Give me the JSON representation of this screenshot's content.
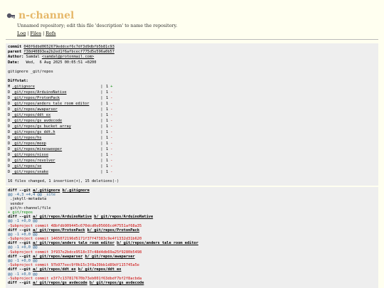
{
  "header": {
    "repo_name": "n-channel",
    "description": "Unnamed repository; edit this file 'description' to name the repository.",
    "nav": {
      "log": "Log",
      "files": "Files",
      "refs": "Refs",
      "sep": "|"
    }
  },
  "commit": {
    "commit_label": "commit",
    "commit_hash": "048f6dbd0652679eddcef6c7df3d9dbfb5b81c93",
    "parent_label": "parent",
    "parent_hash": "f38d40893ea2b2ed1f6afbcecf775d5e596a0b57",
    "author_label": "Author:",
    "author_name": "Samdal",
    "author_email": "<samdal@protonmail.com>",
    "date_label": "Date:",
    "date_value": "Wed,  6 Aug 2025 00:05:51 +0200",
    "message": "gitignore _git/repos",
    "diffstat_label": "Diffstat:",
    "stats": [
      {
        "mode": "M",
        "file": ".gitignore",
        "changes": "1",
        "sign": "+"
      },
      {
        "mode": "D",
        "file": "_git/repos/ArduinoNative",
        "changes": "1",
        "sign": "-"
      },
      {
        "mode": "D",
        "file": "_git/repos/ProtonPack",
        "changes": "1",
        "sign": "-"
      },
      {
        "mode": "D",
        "file": "_git/repos/anders_tale_room_editor",
        "changes": "1",
        "sign": "-"
      },
      {
        "mode": "D",
        "file": "_git/repos/awaparser",
        "changes": "1",
        "sign": "-"
      },
      {
        "mode": "D",
        "file": "_git/repos/ddt_ex",
        "changes": "1",
        "sign": "-"
      },
      {
        "mode": "D",
        "file": "_git/repos/gs_avdecode",
        "changes": "1",
        "sign": "-"
      },
      {
        "mode": "D",
        "file": "_git/repos/gs_bucket_array",
        "changes": "1",
        "sign": "-"
      },
      {
        "mode": "D",
        "file": "_git/repos/gs_ddt.h",
        "changes": "1",
        "sign": "-"
      },
      {
        "mode": "D",
        "file": "_git/repos/hs",
        "changes": "1",
        "sign": "-"
      },
      {
        "mode": "D",
        "file": "_git/repos/meep",
        "changes": "1",
        "sign": "-"
      },
      {
        "mode": "D",
        "file": "_git/repos/minesweeper",
        "changes": "1",
        "sign": "-"
      },
      {
        "mode": "D",
        "file": "_git/repos/nisse",
        "changes": "1",
        "sign": "-"
      },
      {
        "mode": "D",
        "file": "_git/repos/revolver",
        "changes": "1",
        "sign": "-"
      },
      {
        "mode": "D",
        "file": "_git/repos/se",
        "changes": "1",
        "sign": "-"
      },
      {
        "mode": "D",
        "file": "_git/repos/snake",
        "changes": "1",
        "sign": "-"
      }
    ],
    "summary": "16 files changed, 1 insertion(+), 15 deletions(-)"
  },
  "diff": [
    {
      "type": "head",
      "a": "a/.gitignore",
      "b": "b/.gitignore",
      "prefix": "diff --git "
    },
    {
      "type": "hunk",
      "text": "@@ -4,3 +4,4 @@ _site"
    },
    {
      "type": "ctx",
      "text": " .jekyll-metadata"
    },
    {
      "type": "ctx",
      "text": " vendor"
    },
    {
      "type": "ctx",
      "text": " git/n-channel/file"
    },
    {
      "type": "add",
      "text": "+_git/repos"
    },
    {
      "type": "head",
      "a": "a/_git/repos/ArduinoNative",
      "b": "b/_git/repos/ArduinoNative",
      "prefix": "diff --git "
    },
    {
      "type": "hunk",
      "text": "@@ -1 +0,0 @@"
    },
    {
      "type": "del",
      "text": "-Subproject commit 48bfdb909445c670dcd0e05666cd47551af68a35"
    },
    {
      "type": "head",
      "a": "a/_git/repos/ProtonPack",
      "b": "b/_git/repos/ProtonPack",
      "prefix": "diff --git "
    },
    {
      "type": "hunk",
      "text": "@@ -1 +0,0 @@"
    },
    {
      "type": "del",
      "text": "-Subproject commit 1465072196d5171f37f47383c9e4f1332d31b620"
    },
    {
      "type": "head",
      "a": "a/_git/repos/anders_tale_room_editor",
      "b": "b/_git/repos/anders_tale_room_editor",
      "prefix": "diff --git "
    },
    {
      "type": "hunk",
      "text": "@@ -1 +0,0 @@"
    },
    {
      "type": "del",
      "text": "-Subproject commit 3f937e2bdce9518c37c48d4db69a25f9280b5498"
    },
    {
      "type": "head",
      "a": "a/_git/repos/awaparser",
      "b": "b/_git/repos/awaparser",
      "prefix": "diff --git "
    },
    {
      "type": "hunk",
      "text": "@@ -1 +0,0 @@"
    },
    {
      "type": "del",
      "text": "-Subproject commit 97b977eec9f0b15c3f8a39bb1d89df115745a5e"
    },
    {
      "type": "head",
      "a": "a/_git/repos/ddt_ex",
      "b": "b/_git/repos/ddt_ex",
      "prefix": "diff --git "
    },
    {
      "type": "hunk",
      "text": "@@ -1 +0,0 @@"
    },
    {
      "type": "del",
      "text": "-Subproject commit e3f7c137817670b73eb001f63dbdf7bf2f8acbda"
    },
    {
      "type": "head",
      "a": "a/_git/repos/gs_avdecode",
      "b": "b/_git/repos/gs_avdecode",
      "prefix": "diff --git "
    }
  ]
}
